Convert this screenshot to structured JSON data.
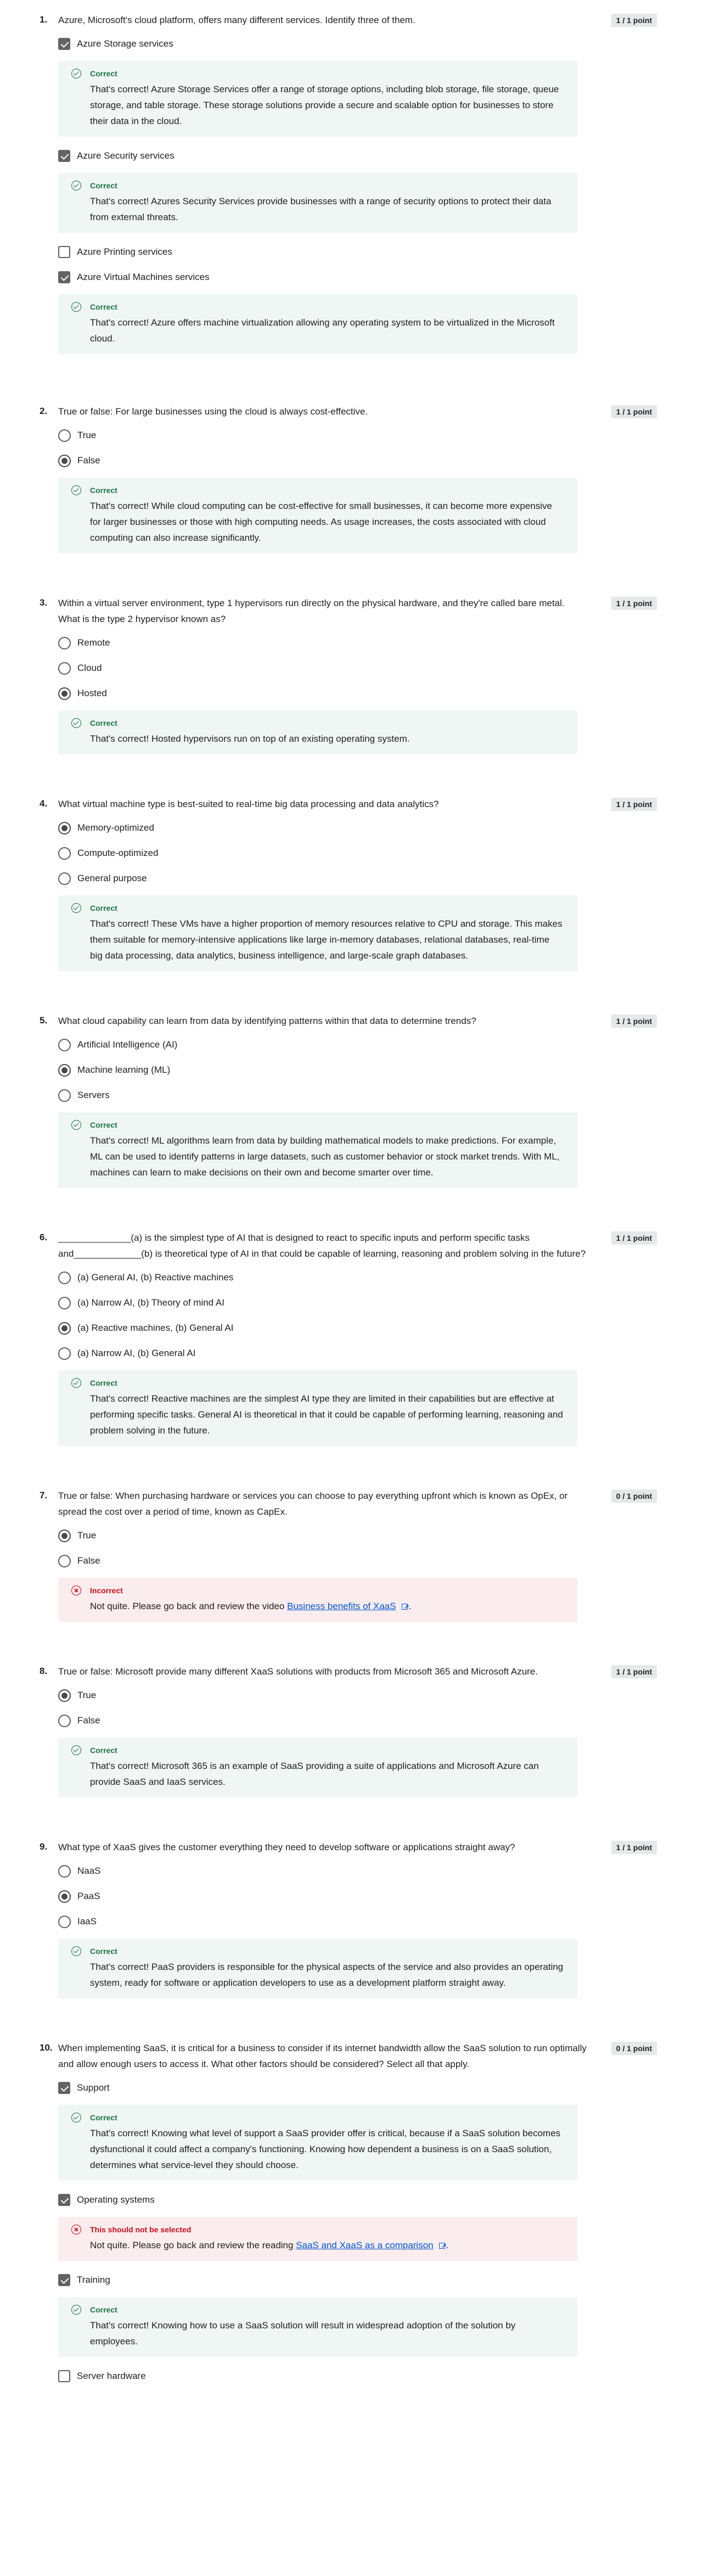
{
  "questions": [
    {
      "number": "1.",
      "text": "Azure, Microsoft's cloud platform, offers many different services. Identify three of them.",
      "points": "1 / 1 point",
      "type": "checkbox",
      "options": [
        {
          "label": "Azure Storage services",
          "selected": true,
          "feedback": {
            "status": "correct",
            "title": "Correct",
            "text": "That's correct! Azure Storage Services offer a range of storage options, including blob storage, file storage, queue storage, and table storage. These storage solutions provide a secure and scalable option for businesses to store their data in the cloud."
          }
        },
        {
          "label": "Azure Security services",
          "selected": true,
          "feedback": {
            "status": "correct",
            "title": "Correct",
            "text": "That's correct! Azures Security Services provide businesses with a range of security options to protect their data from external threats."
          }
        },
        {
          "label": "Azure Printing services",
          "selected": false
        },
        {
          "label": "Azure Virtual Machines services",
          "selected": true,
          "feedback": {
            "status": "correct",
            "title": "Correct",
            "text": "That's correct! Azure offers machine virtualization allowing any operating system to be virtualized in the Microsoft cloud."
          }
        }
      ]
    },
    {
      "number": "2.",
      "text": "True or false: For large businesses using the cloud is always cost-effective.",
      "points": "1 / 1 point",
      "type": "radio",
      "options": [
        {
          "label": "True",
          "selected": false
        },
        {
          "label": "False",
          "selected": true,
          "feedback": {
            "status": "correct",
            "title": "Correct",
            "text": "That's correct! While cloud computing can be cost-effective for small businesses, it can become more expensive for larger businesses or those with high computing needs. As usage increases, the costs associated with cloud computing can also increase significantly."
          }
        }
      ]
    },
    {
      "number": "3.",
      "text": "Within a virtual server environment, type 1 hypervisors run directly on the physical hardware, and they're called bare metal. What is the type 2 hypervisor known as?",
      "points": "1 / 1 point",
      "type": "radio",
      "options": [
        {
          "label": "Remote",
          "selected": false
        },
        {
          "label": "Cloud",
          "selected": false
        },
        {
          "label": "Hosted",
          "selected": true,
          "feedback": {
            "status": "correct",
            "title": "Correct",
            "text": "That's correct! Hosted hypervisors run on top of an existing operating system."
          }
        }
      ]
    },
    {
      "number": "4.",
      "text": "What virtual machine type is best-suited to real-time big data processing and data analytics?",
      "points": "1 / 1 point",
      "type": "radio",
      "options": [
        {
          "label": "Memory-optimized",
          "selected": true
        },
        {
          "label": "Compute-optimized",
          "selected": false
        },
        {
          "label": "General purpose",
          "selected": false,
          "feedback": {
            "status": "correct",
            "title": "Correct",
            "text": "That's correct! These VMs have a higher proportion of memory resources relative to CPU and storage. This makes them suitable for memory-intensive applications like large in-memory databases, relational databases, real-time big data processing, data analytics, business intelligence, and large-scale graph databases."
          }
        }
      ]
    },
    {
      "number": "5.",
      "text": "What cloud capability can learn from data by identifying patterns within that data to determine trends?",
      "points": "1 / 1 point",
      "type": "radio",
      "options": [
        {
          "label": "Artificial Intelligence (AI)",
          "selected": false
        },
        {
          "label": "Machine learning (ML)",
          "selected": true
        },
        {
          "label": "Servers",
          "selected": false,
          "feedback": {
            "status": "correct",
            "title": "Correct",
            "text": "That's correct! ML algorithms learn from data by building mathematical models to make predictions. For example, ML can be used to identify patterns in large datasets, such as customer behavior or stock market trends. With ML, machines can learn to make decisions on their own and become smarter over time."
          }
        }
      ]
    },
    {
      "number": "6.",
      "text": "______________(a) is the simplest type of AI that is designed to react to specific inputs and perform specific tasks and_____________(b) is theoretical type of AI in that could be capable of learning, reasoning and problem solving in the future?",
      "points": "1 / 1 point",
      "type": "radio",
      "options": [
        {
          "label": "(a) General AI, (b) Reactive machines",
          "selected": false
        },
        {
          "label": "(a) Narrow AI, (b) Theory of mind AI",
          "selected": false
        },
        {
          "label": "(a) Reactive machines, (b) General AI",
          "selected": true
        },
        {
          "label": "(a) Narrow AI, (b) General AI",
          "selected": false,
          "feedback": {
            "status": "correct",
            "title": "Correct",
            "text": "That's correct! Reactive machines are the simplest AI type they are limited in their capabilities but are effective at performing specific tasks. General AI is theoretical in that it could be capable of performing learning, reasoning and problem solving in the future."
          }
        }
      ]
    },
    {
      "number": "7.",
      "text": "True or false: When purchasing hardware or services you can choose to pay everything upfront which is known as OpEx, or spread the cost over a period of time, known as CapEx.",
      "points": "0 / 1 point",
      "type": "radio",
      "options": [
        {
          "label": "True",
          "selected": true
        },
        {
          "label": "False",
          "selected": false,
          "feedback": {
            "status": "incorrect",
            "title": "Incorrect",
            "text": "Not quite. Please go back and review the video ",
            "link": "Business benefits of XaaS",
            "after": "."
          }
        }
      ]
    },
    {
      "number": "8.",
      "text": "True or false: Microsoft provide many different XaaS solutions with products from Microsoft 365 and Microsoft Azure.",
      "points": "1 / 1 point",
      "type": "radio",
      "options": [
        {
          "label": "True",
          "selected": true
        },
        {
          "label": "False",
          "selected": false,
          "feedback": {
            "status": "correct",
            "title": "Correct",
            "text": "That's correct! Microsoft 365 is an example of SaaS providing a suite of applications and Microsoft Azure can provide SaaS and IaaS services."
          }
        }
      ]
    },
    {
      "number": "9.",
      "text": "What type of XaaS gives the customer everything they need to develop software or applications straight away?",
      "points": "1 / 1 point",
      "type": "radio",
      "options": [
        {
          "label": "NaaS",
          "selected": false
        },
        {
          "label": "PaaS",
          "selected": true
        },
        {
          "label": "IaaS",
          "selected": false,
          "feedback": {
            "status": "correct",
            "title": "Correct",
            "text": "That's correct! PaaS providers is responsible for the physical aspects of the service and also provides an operating system, ready for software or application developers to use as a development platform straight away."
          }
        }
      ]
    },
    {
      "number": "10.",
      "text": "When implementing SaaS, it is critical for a business to consider if its internet bandwidth allow the SaaS solution to run optimally and allow enough users to access it. What other factors should be considered? Select all that apply.",
      "points": "0 / 1 point",
      "type": "checkbox",
      "options": [
        {
          "label": "Support",
          "selected": true,
          "feedback": {
            "status": "correct",
            "title": "Correct",
            "text": "That's correct! Knowing what level of support a SaaS provider offer is critical, because if a SaaS solution becomes dysfunctional it could affect a company's functioning. Knowing how dependent a business is on a SaaS solution, determines what service-level they should choose."
          }
        },
        {
          "label": "Operating systems",
          "selected": true,
          "feedback": {
            "status": "incorrect",
            "title": "This should not be selected",
            "text": "Not quite. Please go back and review the reading ",
            "link": "SaaS and XaaS as a comparison",
            "after": "."
          }
        },
        {
          "label": "Training",
          "selected": true,
          "feedback": {
            "status": "correct",
            "title": "Correct",
            "text": "That's correct! Knowing how to use a SaaS solution will result in widespread adoption of the solution by employees."
          }
        },
        {
          "label": "Server hardware",
          "selected": false
        }
      ]
    }
  ]
}
